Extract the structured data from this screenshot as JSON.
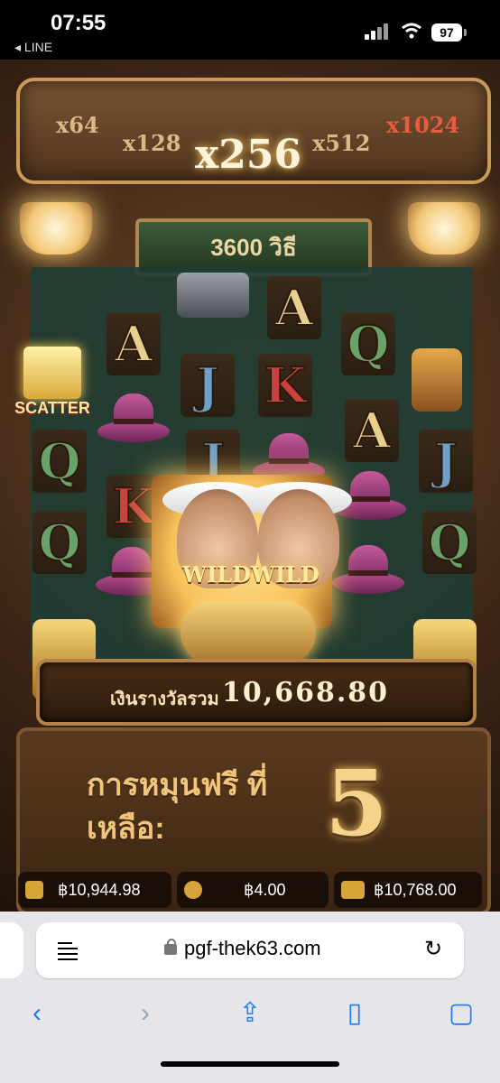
{
  "status_bar": {
    "time": "07:55",
    "back_app": "◂ LINE",
    "battery": "97"
  },
  "game": {
    "multipliers": [
      "x64",
      "x128",
      "x256",
      "x512",
      "x1024"
    ],
    "ways": "3600 วิธี",
    "scatter_label": "SCATTER",
    "wild_label": "WILDWILD",
    "win_label": "เงินรางวัลรวม",
    "win_amount": "10,668.80",
    "free_spins_label": "การหมุนฟรี ที่เหลือ:",
    "free_spins_count": "5",
    "balance": "฿10,944.98",
    "bet": "฿4.00",
    "win_total": "฿10,768.00",
    "symbols": {
      "a": "A",
      "q": "Q",
      "j": "J",
      "k": "K"
    }
  },
  "browser": {
    "url": "pgf-thek63.com"
  },
  "icons": {
    "reader": "reader-icon",
    "lock": "lock-icon",
    "reload": "reload-icon",
    "back": "back-icon",
    "forward": "forward-icon",
    "share": "share-icon",
    "bookmarks": "bookmarks-icon",
    "tabs": "tabs-icon"
  }
}
